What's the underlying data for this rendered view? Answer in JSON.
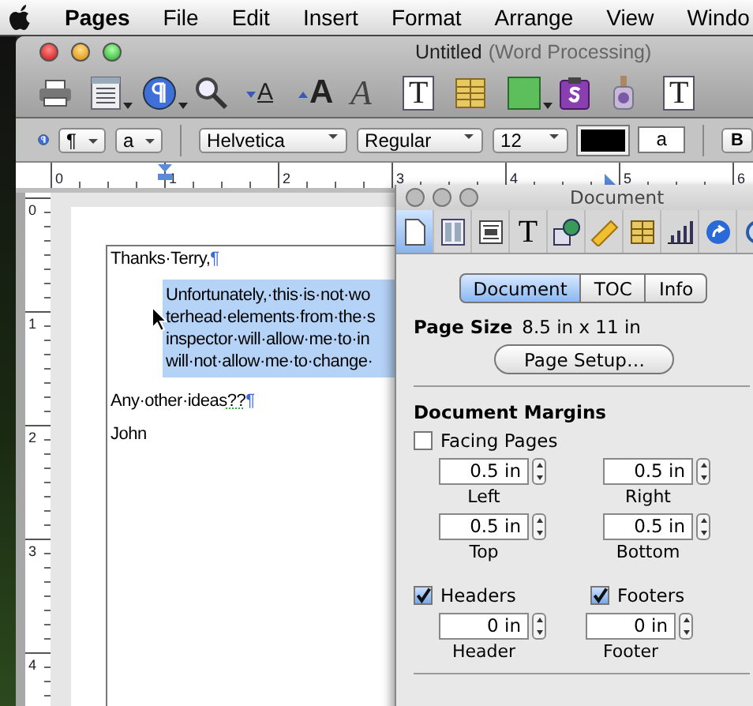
{
  "menu_bar": {
    "app_name": "Pages",
    "items": [
      "File",
      "Edit",
      "Insert",
      "Format",
      "Arrange",
      "View",
      "Windo"
    ]
  },
  "window": {
    "title": "Untitled",
    "subtitle": "(Word Processing)"
  },
  "toolbar": [
    {
      "kind": "printer",
      "menu": false
    },
    {
      "kind": "view",
      "menu": true
    },
    {
      "kind": "sections",
      "menu": true
    },
    {
      "kind": "zoom",
      "menu": false
    },
    {
      "kind": "smaller",
      "glyph": "A",
      "menu": false
    },
    {
      "kind": "bigger",
      "glyph": "A",
      "menu": false
    },
    {
      "kind": "fonts",
      "glyph": "A",
      "menu": false
    },
    {
      "kind": "textbox",
      "glyph": "T",
      "menu": false
    },
    {
      "kind": "table",
      "menu": false
    },
    {
      "kind": "shape",
      "menu": true
    },
    {
      "kind": "comment",
      "menu": false
    },
    {
      "kind": "adjust",
      "menu": false
    },
    {
      "kind": "mask",
      "glyph": "T",
      "menu": false
    }
  ],
  "format_bar": {
    "paragraph_style": "¶",
    "character_style": "a",
    "font": "Helvetica",
    "typeface": "Regular",
    "size": "12",
    "highlight": "a",
    "bold": "B"
  },
  "ruler": [
    "0",
    "1",
    "2",
    "3",
    "4",
    "5",
    "6"
  ],
  "vertical_ruler": [
    "0",
    "1",
    "2",
    "3",
    "4"
  ],
  "document": {
    "paragraphs": [
      {
        "lines": [
          "Thanks·Terry,"
        ],
        "pilcrow": "¶",
        "indent": false,
        "selected": false
      },
      {
        "lines": [
          "Unfortunately,·this·is·not·wo",
          "terhead·elements·from·the·s",
          "inspector·will·allow·me·to·in",
          "will·not·allow·me·to·change·"
        ],
        "indent": true,
        "selected": true
      },
      {
        "lines": [
          "Any·other·ideas"
        ],
        "flagged": "??",
        "pilcrow": "¶",
        "indent": false,
        "selected": false
      },
      {
        "lines": [
          "John"
        ],
        "indent": false,
        "selected": false
      }
    ]
  },
  "inspector": {
    "title": "Document",
    "tools": [
      {
        "kind": "page",
        "selected": true
      },
      {
        "kind": "columns",
        "selected": false
      },
      {
        "kind": "layout",
        "selected": false
      },
      {
        "kind": "text",
        "glyph": "T",
        "selected": false
      },
      {
        "kind": "shape",
        "selected": false
      },
      {
        "kind": "ruler",
        "selected": false
      },
      {
        "kind": "table",
        "selected": false
      },
      {
        "kind": "chart",
        "selected": false
      },
      {
        "kind": "link",
        "selected": false
      },
      {
        "kind": "media",
        "selected": false
      }
    ],
    "tabs": [
      {
        "label": "Document",
        "selected": true
      },
      {
        "label": "TOC",
        "selected": false
      },
      {
        "label": "Info",
        "selected": false
      }
    ],
    "page_size_label": "Page Size",
    "page_size": "8.5 in x 11 in",
    "page_setup": "Page Setup…",
    "margins_heading": "Document Margins",
    "facing_pages": {
      "label": "Facing Pages",
      "checked": false
    },
    "margins": [
      {
        "label": "Left",
        "value": "0.5 in"
      },
      {
        "label": "Right",
        "value": "0.5 in"
      },
      {
        "label": "Top",
        "value": "0.5 in"
      },
      {
        "label": "Bottom",
        "value": "0.5 in"
      }
    ],
    "toggles": [
      {
        "label": "Headers",
        "checked": true
      },
      {
        "label": "Footers",
        "checked": true
      }
    ],
    "header_footer": [
      {
        "label": "Header",
        "value": "0 in"
      },
      {
        "label": "Footer",
        "value": "0 in"
      }
    ]
  }
}
